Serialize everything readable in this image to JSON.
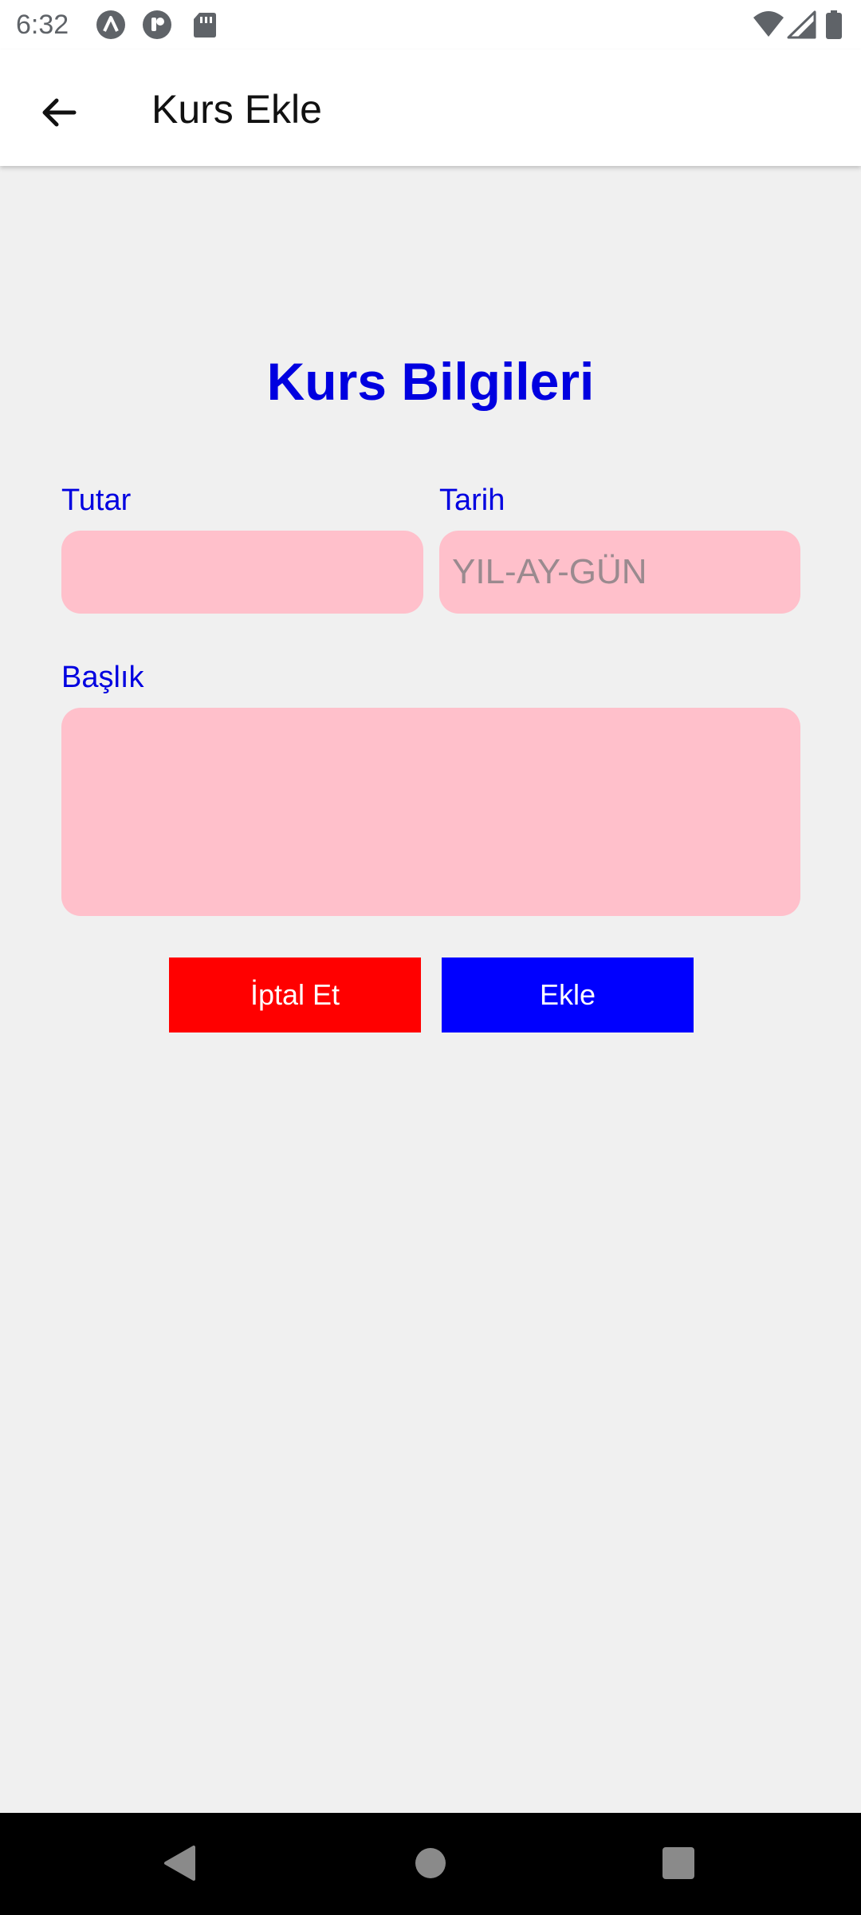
{
  "status_bar": {
    "time": "6:32",
    "left_icons": [
      "app-notification-icon",
      "pocket-icon",
      "sd-card-icon"
    ],
    "right_icons": [
      "wifi-icon",
      "cell-signal-icon",
      "battery-icon"
    ]
  },
  "app_bar": {
    "back_icon": "arrow-back-icon",
    "title": "Kurs Ekle"
  },
  "form": {
    "heading": "Kurs Bilgileri",
    "amount": {
      "label": "Tutar",
      "value": "",
      "placeholder": ""
    },
    "date": {
      "label": "Tarih",
      "value": "",
      "placeholder": "YIL-AY-GÜN"
    },
    "title_field": {
      "label": "Başlık",
      "value": "",
      "placeholder": ""
    },
    "cancel_label": "İptal Et",
    "add_label": "Ekle"
  },
  "nav_bar": {
    "icons": [
      "nav-back-icon",
      "nav-home-icon",
      "nav-recents-icon"
    ]
  },
  "colors": {
    "accent_blue": "#0000e0",
    "input_bg": "#ffc0cb",
    "cancel_bg": "#ff0000",
    "add_bg": "#0000ff",
    "screen_bg": "#f0f0f0"
  }
}
